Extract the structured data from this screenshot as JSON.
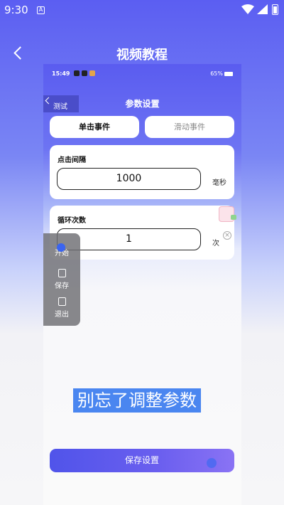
{
  "status_bar": {
    "time": "9:30",
    "notification_icon": "A"
  },
  "header": {
    "back_icon": "chevron-left-icon",
    "title": "视频教程"
  },
  "inner": {
    "status": {
      "time": "15:49",
      "right": "65%"
    },
    "test_tag": "测试",
    "title": "参数设置",
    "tabs": [
      {
        "label": "单击事件",
        "selected": true
      },
      {
        "label": "滑动事件",
        "selected": false
      }
    ],
    "interval": {
      "label": "点击间隔",
      "value": "1000",
      "unit": "毫秒"
    },
    "loop": {
      "label": "循环次数",
      "value": "1",
      "unit": "次"
    },
    "side_panel": [
      {
        "label": "开始",
        "icon": "play-icon"
      },
      {
        "label": "保存",
        "icon": "save-icon"
      },
      {
        "label": "退出",
        "icon": "exit-icon"
      }
    ],
    "caption": "别忘了调整参数",
    "save_button": "保存设置"
  }
}
